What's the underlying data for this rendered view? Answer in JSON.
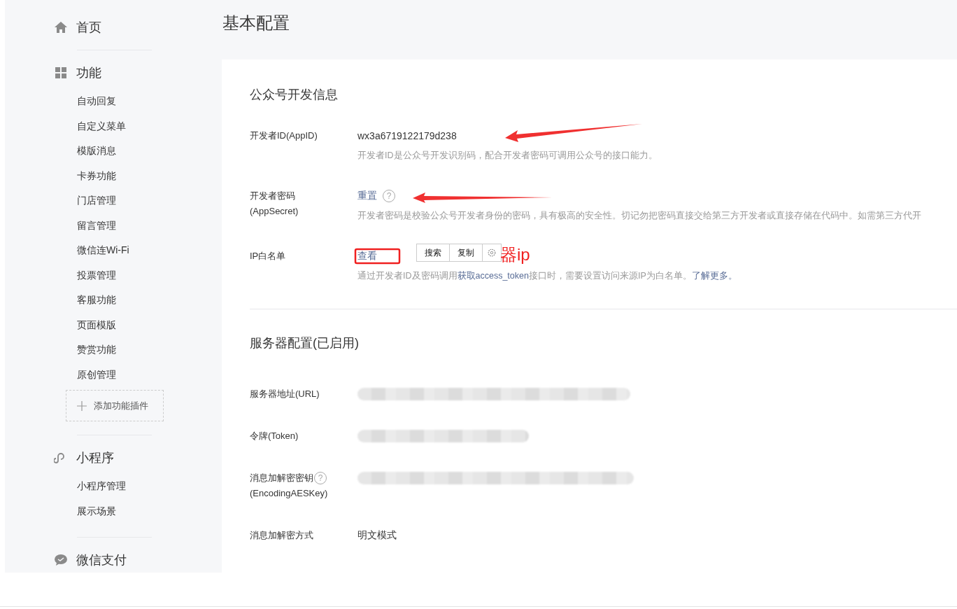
{
  "page_title": "基本配置",
  "sidebar": {
    "sections": [
      {
        "title": "首页",
        "selected": false
      },
      {
        "title": "功能",
        "selected": false,
        "items": [
          "自动回复",
          "自定义菜单",
          "模版消息",
          "卡券功能",
          "门店管理",
          "留言管理",
          "微信连Wi-Fi",
          "投票管理",
          "客服功能",
          "页面模版",
          "赞赏功能",
          "原创管理"
        ],
        "add_button": "添加功能插件"
      },
      {
        "title": "小程序",
        "selected": false,
        "items": [
          "小程序管理",
          "展示场景"
        ]
      },
      {
        "title": "微信支付",
        "selected": false
      }
    ]
  },
  "sections": [
    {
      "title": "公众号开发信息",
      "fields": [
        {
          "label": "开发者ID(AppID)",
          "kind": "text",
          "value": "wx3a6719122179d238",
          "description": [
            {
              "text": "开发者ID是公众号开发识别码，配合开发者密码可调用公众号的接口能力。",
              "link": false
            }
          ]
        },
        {
          "label": "开发者密码",
          "label_line2": "(AppSecret)",
          "kind": "link",
          "value": "重置",
          "value_help": "?",
          "description": [
            {
              "text": "开发者密码是校验公众号开发者身份的密码，具有极高的安全性。切记勿把密码直接交给第三方开发者或直接存储在代码中。如需第三方代开",
              "link": false
            }
          ]
        },
        {
          "label": "IP白名单",
          "kind": "link",
          "value": "查看",
          "description": [
            {
              "text": "通过开发者ID及密码调用",
              "link": false
            },
            {
              "text": "获取access_token",
              "link": true
            },
            {
              "text": "接口时，需要设置访问来源IP为白名单。",
              "link": false
            },
            {
              "text": "了解更多。",
              "link": true
            }
          ]
        }
      ]
    },
    {
      "title": "服务器配置(已启用)",
      "fields": [
        {
          "label": "服务器地址(URL)",
          "kind": "redacted"
        },
        {
          "label": "令牌(Token)",
          "kind": "redacted"
        },
        {
          "label": "消息加解密密钥",
          "label_help": "?",
          "label_line2": "(EncodingAESKey)",
          "kind": "redacted"
        },
        {
          "label": "消息加解密方式",
          "kind": "text",
          "value": "明文模式"
        }
      ]
    }
  ],
  "context_menu": {
    "items": [
      "搜索",
      "复制"
    ]
  },
  "annotation": {
    "text": "器ip"
  }
}
